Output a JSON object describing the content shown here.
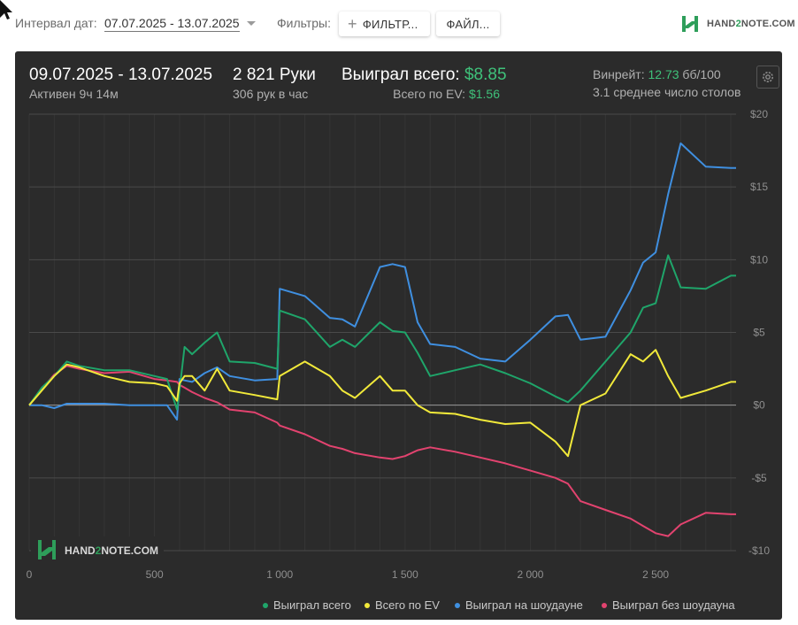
{
  "toolbar": {
    "date_label": "Интервал дат:",
    "date_value": "07.07.2025 - 13.07.2025",
    "filters_label": "Фильтры:",
    "filter_button": "ФИЛЬТР...",
    "file_button": "ФАЙЛ...",
    "logo": "HAND2NOTE.COM",
    "logo_a": "HAND",
    "logo_b": "2",
    "logo_c": "NOTE.COM"
  },
  "summary": {
    "period": "09.07.2025 - 13.07.2025",
    "active": "Активен 9ч 14м",
    "hands": "2 821 Руки",
    "hands_per_hour": "306 рук в час",
    "won_label": "Выиграл всего:",
    "won_value": "$8.85",
    "ev_label": "Всего по EV:",
    "ev_value": "$1.56",
    "winrate_label": "Винрейт:",
    "winrate_value": "12.73",
    "winrate_unit": "бб/100",
    "avg_tables": "3.1 среднее число столов"
  },
  "watermark": {
    "text": "HAND2NOTE.COM",
    "a": "HAND",
    "b": "2",
    "c": "NOTE.COM"
  },
  "colors": {
    "won": "#1fa56a",
    "ev": "#f1e93a",
    "showdown": "#3f8fe0",
    "non_showdown": "#e2436f",
    "accent": "#3fc17a"
  },
  "chart_data": {
    "type": "line",
    "xlabel": "",
    "ylabel": "",
    "xlim": [
      0,
      2821
    ],
    "ylim": [
      -10,
      20
    ],
    "x_ticks": [
      0,
      500,
      1000,
      1500,
      2000,
      2500
    ],
    "x_tick_labels": [
      "0",
      "500",
      "1 000",
      "1 500",
      "2 000",
      "2 500"
    ],
    "y_ticks": [
      20,
      15,
      10,
      5,
      0,
      -5,
      -10
    ],
    "y_tick_labels": [
      "$20",
      "$15",
      "$10",
      "$5",
      "$0",
      "-$5",
      "-$10"
    ],
    "grid": true,
    "legend_position": "bottom-right",
    "x": [
      0,
      50,
      100,
      150,
      200,
      300,
      400,
      500,
      550,
      590,
      600,
      620,
      650,
      700,
      750,
      800,
      900,
      990,
      1000,
      1100,
      1200,
      1250,
      1300,
      1400,
      1450,
      1500,
      1550,
      1600,
      1700,
      1800,
      1900,
      2000,
      2100,
      2150,
      2200,
      2300,
      2400,
      2450,
      2500,
      2550,
      2600,
      2700,
      2800,
      2821
    ],
    "series": [
      {
        "name": "Выиграл всего",
        "color_key": "won",
        "values": [
          0,
          1.2,
          2.0,
          3.0,
          2.7,
          2.4,
          2.4,
          2.0,
          1.8,
          -0.3,
          1.0,
          4.0,
          3.5,
          4.3,
          5.0,
          3.0,
          2.9,
          2.5,
          6.5,
          5.9,
          4.0,
          4.5,
          4.0,
          5.7,
          5.1,
          5.0,
          3.6,
          2.0,
          2.4,
          2.8,
          2.2,
          1.5,
          0.6,
          0.2,
          1.0,
          3.0,
          5.0,
          6.7,
          7.0,
          10.3,
          8.1,
          8.0,
          8.9,
          8.9
        ]
      },
      {
        "name": "Всего по EV",
        "color_key": "ev",
        "values": [
          0,
          1.0,
          2.0,
          2.8,
          2.6,
          2.0,
          1.6,
          1.5,
          1.3,
          0.3,
          1.5,
          2.0,
          2.0,
          1.0,
          2.5,
          1.0,
          0.7,
          0.4,
          2.0,
          3.0,
          2.0,
          1.0,
          0.5,
          2.0,
          1.0,
          1.0,
          0.0,
          -0.5,
          -0.6,
          -1.0,
          -1.3,
          -1.2,
          -2.5,
          -3.5,
          0.0,
          0.8,
          3.5,
          3.0,
          3.8,
          2.0,
          0.5,
          1.0,
          1.6,
          1.6
        ]
      },
      {
        "name": "Выиграл на шоудауне",
        "color_key": "showdown",
        "values": [
          0,
          0.0,
          -0.2,
          0.1,
          0.1,
          0.1,
          0.0,
          0.0,
          0.0,
          -1.0,
          1.8,
          1.7,
          1.6,
          2.2,
          2.6,
          2.0,
          1.7,
          1.8,
          8.0,
          7.5,
          6.0,
          5.9,
          5.4,
          9.5,
          9.7,
          9.5,
          5.7,
          4.2,
          4.0,
          3.2,
          3.0,
          4.5,
          6.1,
          6.2,
          4.5,
          4.7,
          7.9,
          9.8,
          10.5,
          14.5,
          18.0,
          16.4,
          16.3,
          16.3
        ]
      },
      {
        "name": "Выиграл без шоудауна",
        "color_key": "non_showdown",
        "values": [
          0,
          1.1,
          2.1,
          2.7,
          2.5,
          2.2,
          2.3,
          1.8,
          1.7,
          1.6,
          1.4,
          1.2,
          0.9,
          0.5,
          0.2,
          -0.3,
          -0.5,
          -1.2,
          -1.4,
          -2.0,
          -2.8,
          -3.0,
          -3.3,
          -3.6,
          -3.7,
          -3.5,
          -3.1,
          -2.9,
          -3.2,
          -3.6,
          -4.0,
          -4.5,
          -5.0,
          -5.4,
          -6.6,
          -7.2,
          -7.8,
          -8.3,
          -8.8,
          -9.0,
          -8.2,
          -7.4,
          -7.5,
          -7.5
        ]
      }
    ]
  }
}
